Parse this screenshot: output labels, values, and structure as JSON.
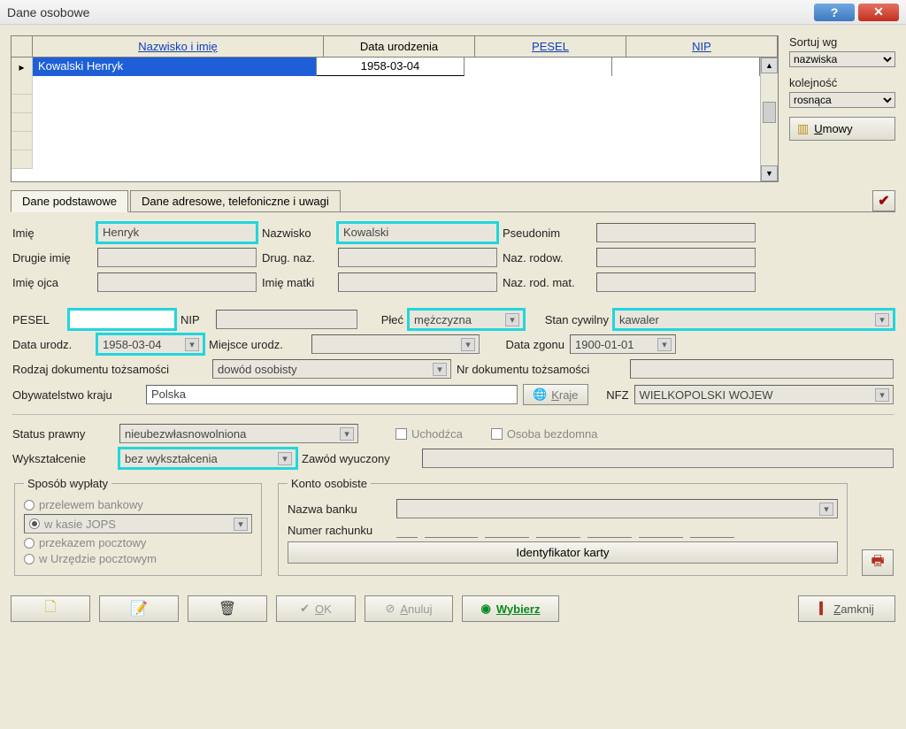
{
  "window": {
    "title": "Dane osobowe"
  },
  "grid": {
    "headers": {
      "name": "Nazwisko i imię",
      "date": "Data urodzenia",
      "pesel": "PESEL",
      "nip": "NIP"
    },
    "rows": [
      {
        "name": "Kowalski Henryk",
        "date": "1958-03-04",
        "pesel": "",
        "nip": ""
      }
    ]
  },
  "side": {
    "sort_label": "Sortuj wg",
    "sort_value": "nazwiska",
    "order_label": "kolejność",
    "order_value": "rosnąca",
    "umowy_label": "Umowy"
  },
  "tabs": {
    "basic": "Dane podstawowe",
    "address": "Dane adresowe, telefoniczne i uwagi"
  },
  "labels": {
    "imie": "Imię",
    "nazwisko": "Nazwisko",
    "pseudonim": "Pseudonim",
    "drugie_imie": "Drugie imię",
    "drug_naz": "Drug. naz.",
    "naz_rodow": "Naz. rodow.",
    "imie_ojca": "Imię ojca",
    "imie_matki": "Imię matki",
    "naz_rod_mat": "Naz. rod. mat.",
    "pesel": "PESEL",
    "nip": "NIP",
    "plec": "Płeć",
    "stan": "Stan cywilny",
    "data_ur": "Data urodz.",
    "miejsce_ur": "Miejsce urodz.",
    "data_zgonu": "Data zgonu",
    "rodzaj_dok": "Rodzaj dokumentu tożsamości",
    "nr_dok": "Nr dokumentu tożsamości",
    "obyw": "Obywatelstwo kraju",
    "kraje": "Kraje",
    "nfz": "NFZ",
    "status": "Status prawny",
    "uchodzca": "Uchodźca",
    "bezdomna": "Osoba bezdomna",
    "wykszt": "Wykształcenie",
    "zawod": "Zawód wyuczony",
    "sposob": "Sposób wypłaty",
    "konto": "Konto osobiste",
    "bank": "Nazwa banku",
    "rachunek": "Numer rachunku",
    "id_karty": "Identyfikator karty"
  },
  "values": {
    "imie": "Henryk",
    "nazwisko": "Kowalski",
    "pseudonim": "",
    "drugie_imie": "",
    "drug_naz": "",
    "naz_rodow": "",
    "imie_ojca": "",
    "imie_matki": "",
    "naz_rod_mat": "",
    "pesel": "",
    "nip": "",
    "plec": "mężczyzna",
    "stan": "kawaler",
    "data_ur": "1958-03-04",
    "miejsce_ur": "",
    "data_zgonu": "1900-01-01",
    "rodzaj_dok": "dowód osobisty",
    "nr_dok": "",
    "obyw": "Polska",
    "nfz": "WIELKOPOLSKI WOJEW",
    "status": "nieubezwłasnowolniona",
    "wykszt": "bez wykształcenia",
    "zawod": "",
    "bank": "",
    "rachunek": ""
  },
  "radios": {
    "r1": "przelewem bankowy",
    "r2": "w kasie JOPS",
    "r3": "przekazem pocztowy",
    "r4": "w Urzędzie pocztowym"
  },
  "buttons": {
    "ok": "OK",
    "anuluj": "Anuluj",
    "wybierz": "Wybierz",
    "zamknij": "Zamknij"
  }
}
